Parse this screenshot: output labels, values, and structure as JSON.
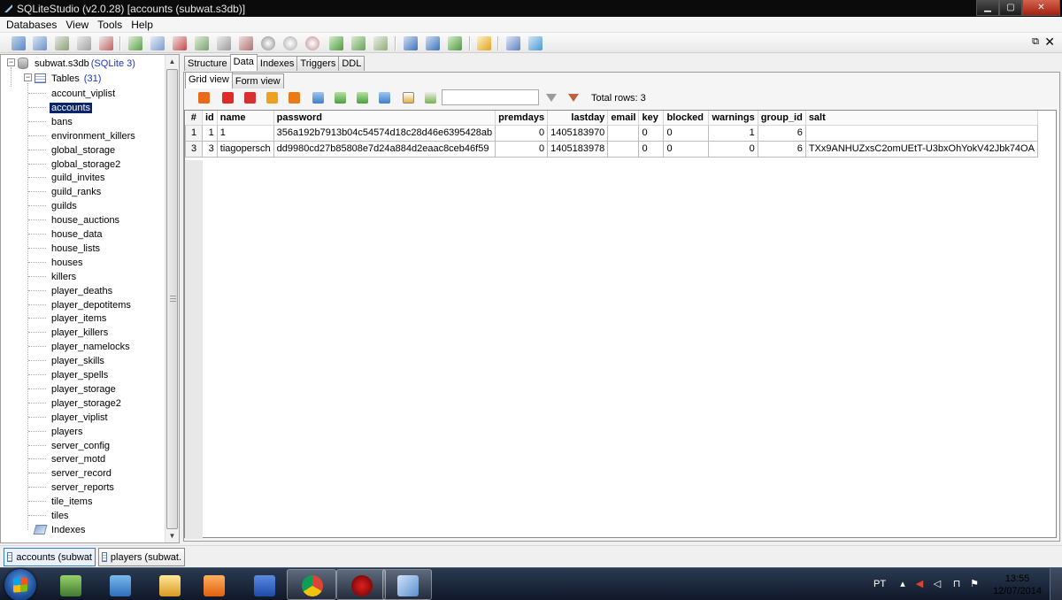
{
  "window": {
    "title": "SQLiteStudio (v2.0.28) [accounts (subwat.s3db)]"
  },
  "menu": [
    "Databases",
    "View",
    "Tools",
    "Help"
  ],
  "tree": {
    "database": "subwat.s3db",
    "database_type": "(SQLite 3)",
    "tables_label": "Tables",
    "tables_count": "(31)",
    "tables": [
      "account_viplist",
      "accounts",
      "bans",
      "environment_killers",
      "global_storage",
      "global_storage2",
      "guild_invites",
      "guild_ranks",
      "guilds",
      "house_auctions",
      "house_data",
      "house_lists",
      "houses",
      "killers",
      "player_deaths",
      "player_depotitems",
      "player_items",
      "player_killers",
      "player_namelocks",
      "player_skills",
      "player_spells",
      "player_storage",
      "player_storage2",
      "player_viplist",
      "players",
      "server_config",
      "server_motd",
      "server_record",
      "server_reports",
      "tile_items",
      "tiles"
    ],
    "selected_table": "accounts",
    "indexes_label": "Indexes"
  },
  "tabs": [
    "Structure",
    "Data",
    "Indexes",
    "Triggers",
    "DDL"
  ],
  "active_tab": "Data",
  "subtabs": [
    "Grid view",
    "Form view"
  ],
  "active_subtab": "Grid view",
  "grid_toolbar": {
    "filter_value": "",
    "total_rows": "Total rows: 3"
  },
  "grid": {
    "columns": [
      "#",
      "id",
      "name",
      "password",
      "premdays",
      "lastday",
      "email",
      "key",
      "blocked",
      "warnings",
      "group_id",
      "salt"
    ],
    "rows": [
      [
        "1",
        "1",
        "1",
        "356a192b7913b04c54574d18c28d46e6395428ab",
        "0",
        "1405183970",
        "",
        "0",
        "0",
        "1",
        "6",
        ""
      ],
      [
        "3",
        "3",
        "tiagopersch",
        "dd9980cd27b85808e7d24a884d2eaac8ceb46f59",
        "0",
        "1405183978",
        "",
        "0",
        "0",
        "0",
        "6",
        "TXx9ANHUZxsC2omUEtT-U3bxOhYokV42Jbk74OA"
      ]
    ]
  },
  "task_tabs": [
    "accounts (subwat",
    "players (subwat."
  ],
  "systray": {
    "language": "PT",
    "time": "13:55",
    "date": "12/07/2014"
  }
}
